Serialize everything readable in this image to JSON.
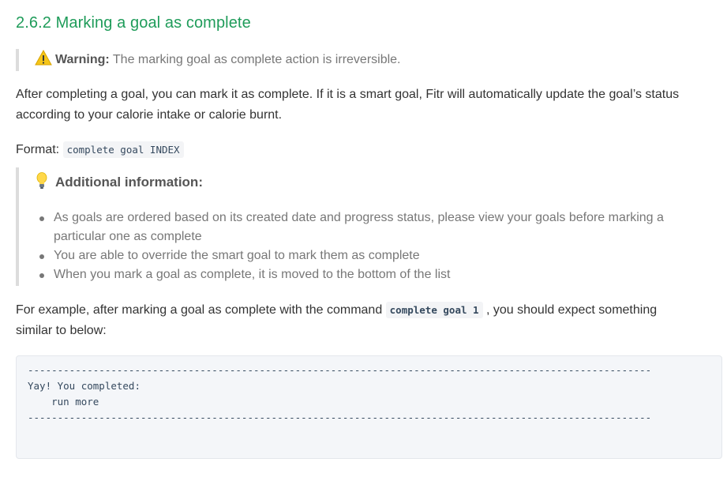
{
  "heading": "2.6.2 Marking a goal as complete",
  "warning": {
    "icon": "warning-icon",
    "label": "Warning:",
    "text": " The marking goal as complete action is irreversible."
  },
  "intro": "After completing a goal, you can mark it as complete. If it is a smart goal, Fitr will automatically update the goal’s status according to your calorie intake or calorie burnt.",
  "format": {
    "label": "Format: ",
    "code": "complete goal INDEX"
  },
  "info": {
    "icon": "lightbulb-icon",
    "title": "Additional information:",
    "items": [
      "As goals are ordered based on its created date and progress status, please view your goals before marking a particular one as complete",
      "You are able to override the smart goal to mark them as complete",
      "When you mark a goal as complete, it is moved to the bottom of the list"
    ]
  },
  "example": {
    "before": "For example, after marking a goal as complete with the command ",
    "code": "complete goal 1",
    "after": " , you should expect something similar to below:"
  },
  "output": {
    "separator": "---------------------------------------------------------------------------------------------------------",
    "line1": "Yay! You completed:",
    "line2": "    run more"
  }
}
